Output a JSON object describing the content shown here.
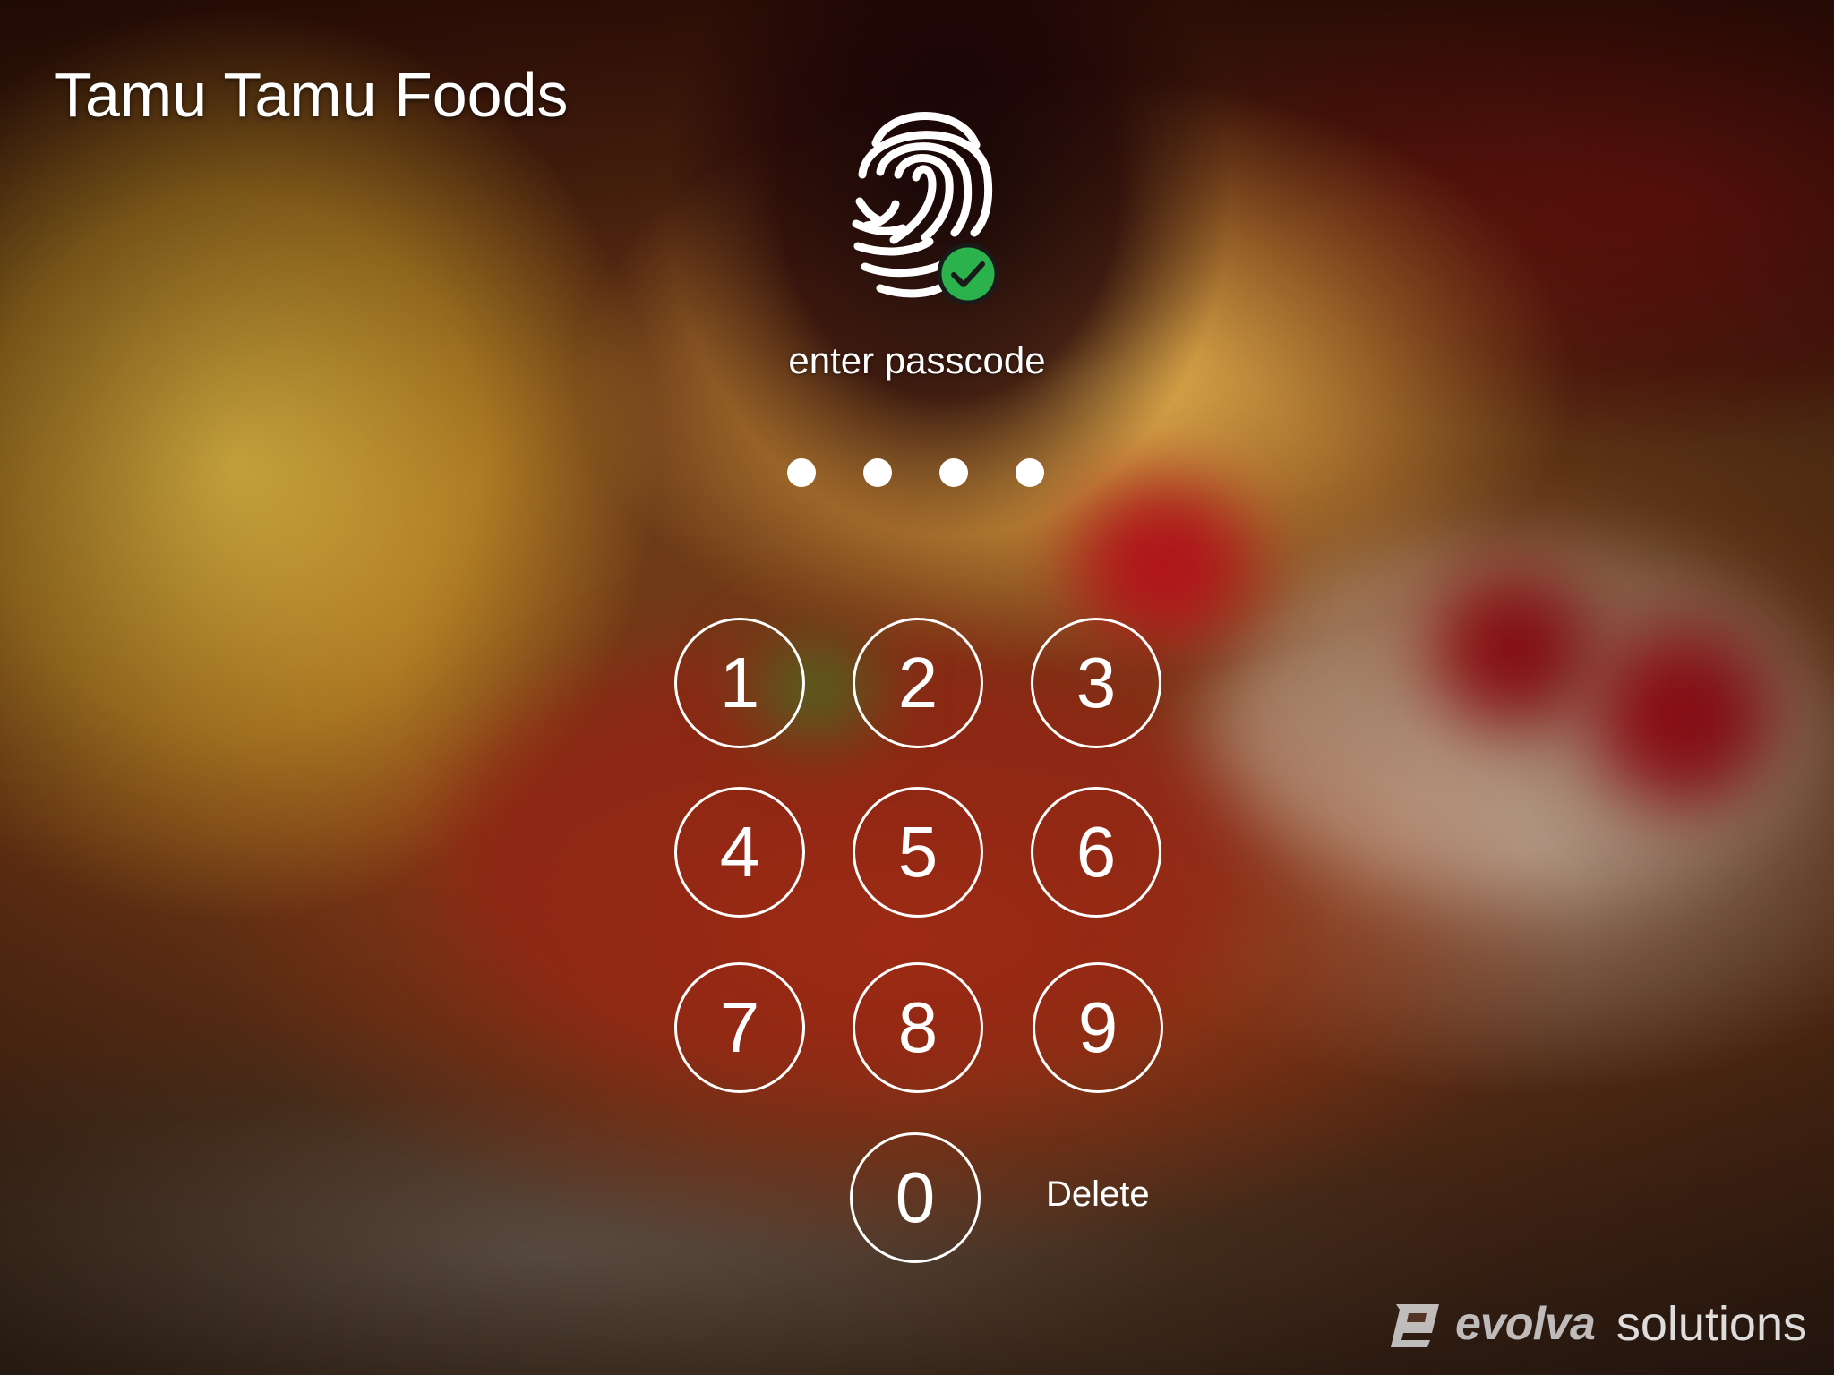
{
  "app": {
    "title": "Tamu Tamu Foods"
  },
  "auth": {
    "fingerprint_icon": "fingerprint-icon",
    "status_icon": "checkmark-icon",
    "status_color": "#2bb24c",
    "prompt": "enter passcode",
    "passcode_length": 4,
    "entered_digits": 4
  },
  "keypad": {
    "keys": [
      "1",
      "2",
      "3",
      "4",
      "5",
      "6",
      "7",
      "8",
      "9",
      "0"
    ],
    "delete_label": "Delete"
  },
  "footer": {
    "brand_name": "evolva",
    "brand_suffix": "solutions",
    "brand_icon": "evolva-logo-icon"
  }
}
